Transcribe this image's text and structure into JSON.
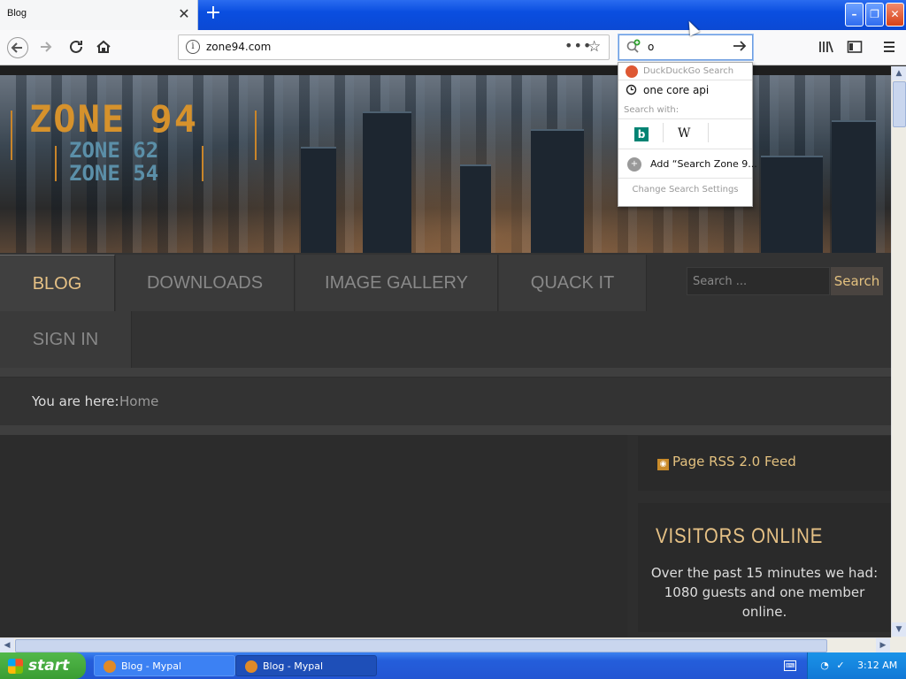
{
  "browser": {
    "tab_title": "Blog",
    "close_tab_glyph": "✕",
    "new_tab_glyph": "+",
    "url": "zone94.com",
    "search_query": "o",
    "window_buttons": {
      "minimize": "–",
      "restore": "❐",
      "close": "✕"
    }
  },
  "search_dropdown": {
    "engine_label": "DuckDuckGo Search",
    "suggestion": "one core api",
    "search_with_label": "Search with:",
    "engines": [
      {
        "name": "bing-icon",
        "glyph": "b"
      },
      {
        "name": "wikipedia-icon",
        "glyph": "W"
      }
    ],
    "add_engine": "Add “Search Zone 9...",
    "change_settings": "Change Search Settings"
  },
  "site": {
    "logo_main": "ZONE 94",
    "logo_sub1": "ZONE 62",
    "logo_sub2": "ZONE 54",
    "menu": [
      {
        "label": "BLOG",
        "active": true
      },
      {
        "label": "DOWNLOADS",
        "active": false
      },
      {
        "label": "IMAGE GALLERY",
        "active": false
      },
      {
        "label": "QUACK IT",
        "active": false
      },
      {
        "label": "SIGN IN",
        "active": false
      }
    ],
    "search_placeholder": "Search ...",
    "search_button": "Search",
    "breadcrumb_label": "You are here:",
    "breadcrumb_home": "Home",
    "rss_label": "Page RSS 2.0 Feed",
    "visitors_title": "VISITORS ONLINE",
    "visitors_text": "Over the past 15 minutes we had: 1080 guests and one member online."
  },
  "taskbar": {
    "start_label": "start",
    "tasks": [
      {
        "label": "Blog - Mypal",
        "active": false
      },
      {
        "label": "Blog - Mypal",
        "active": true
      }
    ],
    "clock": "3:12 AM"
  },
  "colors": {
    "accent_gold": "#e6c185",
    "xp_blue": "#245edb",
    "start_green": "#3a9d33"
  }
}
